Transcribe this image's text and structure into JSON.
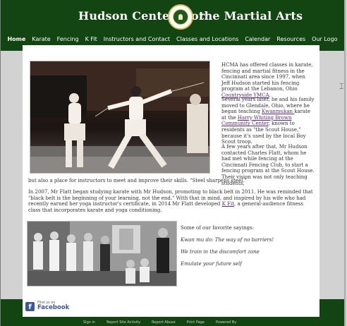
{
  "header": {
    "title_left": "Hudson Centers for",
    "title_right": "the Martial Arts",
    "logo_icon": "dojo-crest-icon",
    "colors": {
      "header_bg": "#134513",
      "text": "#ffffff"
    }
  },
  "nav": {
    "items": [
      {
        "label": "Home",
        "active": true
      },
      {
        "label": "Karate"
      },
      {
        "label": "Fencing"
      },
      {
        "label": "K Fit"
      },
      {
        "label": "Instructors and Contact"
      },
      {
        "label": "Classes and Locations"
      },
      {
        "label": "Calendar"
      },
      {
        "label": "Resources"
      },
      {
        "label": "Our Logo"
      }
    ]
  },
  "main": {
    "intro": {
      "text_before": "HCMA has offered classes in karate, fencing and martial fitness in the Cincinnati area since 1997, when Jeff Hudson started his fencing program at the Lebanon, Ohio ",
      "link": "Countryside YMCA",
      "text_after": "."
    },
    "history": {
      "text_before": "Several years later, he and his family moved to Glendale, Ohio, where he began teaching ",
      "link1": "Kwanmukan ",
      "text_mid": "karate at the ",
      "link2": "Harry Whiting Brown Community Center",
      "text_after": ", known to residents as \"the Scout House,\" because it's used by the local Boy Scout troop."
    },
    "flatt": {
      "text": "A few years after that, Mr Hudson contacted Charles Flatt, whom he had met while fencing at the Cincinnati Fencing Club, to start a fencing program at the Scout House. Their vision was not only teaching students,",
      "text_cont": "but also a place for instructors to meet and improve their skills. \"Steel sharpens steel.\""
    },
    "karate": {
      "text_before": "In 2007, Mr Flatt began studying karate with Mr Hudson, promoting to black belt in 2011. He was reminded that \"black belt is the beginning of your learning, not the end.\" With that in mind, and inspired by his wife who had recently earned her yoga instructor's certificate, in 2014 Mr Flatt developed ",
      "link": "K Fit",
      "text_after": ", a general-audience fitness class that incorporates karate and yoga conditioning."
    },
    "sayings": {
      "title": "Some of our favorite sayings:",
      "items": [
        "Kwan mu do: The way of no barriers!",
        "We train in the discomfort zone",
        "Emulate your future self"
      ]
    }
  },
  "footer": {
    "facebook": {
      "small": "Find us on",
      "big": "Facebook",
      "icon": "facebook-icon"
    },
    "links": [
      "Sign in",
      "Report Site Activity",
      "Report Abuse",
      "Print Page",
      "Powered By"
    ]
  }
}
